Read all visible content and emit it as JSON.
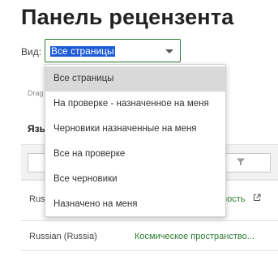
{
  "page": {
    "title": "Панель рецензента"
  },
  "view": {
    "label": "Вид:",
    "selected": "Все страницы"
  },
  "drag_hint": "Drag",
  "table": {
    "language_header": "Язы",
    "rows": [
      {
        "language": "Russ",
        "link": "ность"
      },
      {
        "language": "Russian (Russia)",
        "link": "Космическое пространство..."
      }
    ]
  },
  "dropdown": {
    "options": [
      "Все страницы",
      "На проверке - назначенное на меня",
      "Черновики назначенные на меня",
      "Все на проверке",
      "Все черновики",
      "Назначено на меня"
    ]
  },
  "colors": {
    "accent_green": "#2e7d32",
    "selection_blue": "#1e5bd6",
    "selected_option_bg": "#d9d9d9"
  },
  "icons": {
    "dropdown_caret": "chevron-down-icon",
    "filter": "filter-icon",
    "external_link": "external-link-icon"
  }
}
